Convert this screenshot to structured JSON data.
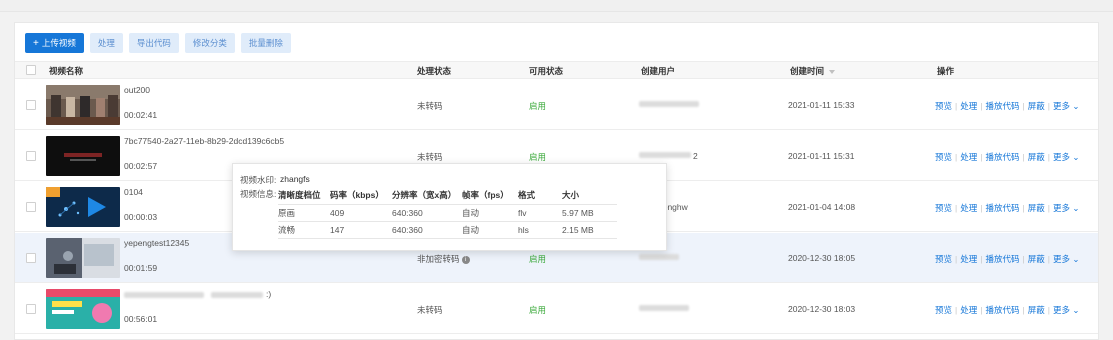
{
  "toolbar": {
    "upload": "上传视频",
    "process": "处理",
    "export_code": "导出代码",
    "modify_category": "修改分类",
    "batch_delete": "批量删除"
  },
  "columns": {
    "name": "视频名称",
    "process_status": "处理状态",
    "availability": "可用状态",
    "creator": "创建用户",
    "created_time": "创建时间",
    "actions": "操作"
  },
  "actions": {
    "preview": "预览",
    "process": "处理",
    "play_code": "播放代码",
    "block": "屏蔽",
    "more": "更多"
  },
  "rows": [
    {
      "name": "out200",
      "duration": "00:02:41",
      "status": "未转码",
      "available": "启用",
      "creator": "",
      "created": "2021-01-11 15:33"
    },
    {
      "name": "7bc77540-2a27-11eb-8b29-2dcd139c6cb5",
      "duration": "00:02:57",
      "status": "未转码",
      "available": "启用",
      "creator": "2",
      "created": "2021-01-11 15:31"
    },
    {
      "name": "0104",
      "duration": "00:00:03",
      "status": "",
      "available": "",
      "creator": "nonghw",
      "created": "2021-01-04 14:08"
    },
    {
      "name": "yepengtest12345",
      "duration": "00:01:59",
      "status": "非加密转码",
      "available": "启用",
      "creator": "",
      "created": "2020-12-30 18:05"
    },
    {
      "name": ":)",
      "duration": "00:56:01",
      "status": "未转码",
      "available": "启用",
      "creator": "",
      "created": "2020-12-30 18:03"
    }
  ],
  "popup": {
    "watermark_label": "视频水印:",
    "watermark_value": "zhangfs",
    "info_label": "视频信息:",
    "headers": [
      "清晰度档位",
      "码率（kbps）",
      "分辨率（宽x高）",
      "帧率（fps）",
      "格式",
      "大小"
    ],
    "rows": [
      [
        "原画",
        "409",
        "640:360",
        "自动",
        "flv",
        "5.97 MB"
      ],
      [
        "流畅",
        "147",
        "640:360",
        "自动",
        "hls",
        "2.15 MB"
      ]
    ]
  },
  "colors": {
    "primary": "#1677d8",
    "success": "#3aa93a",
    "highlight_row": "#eef3fb"
  }
}
